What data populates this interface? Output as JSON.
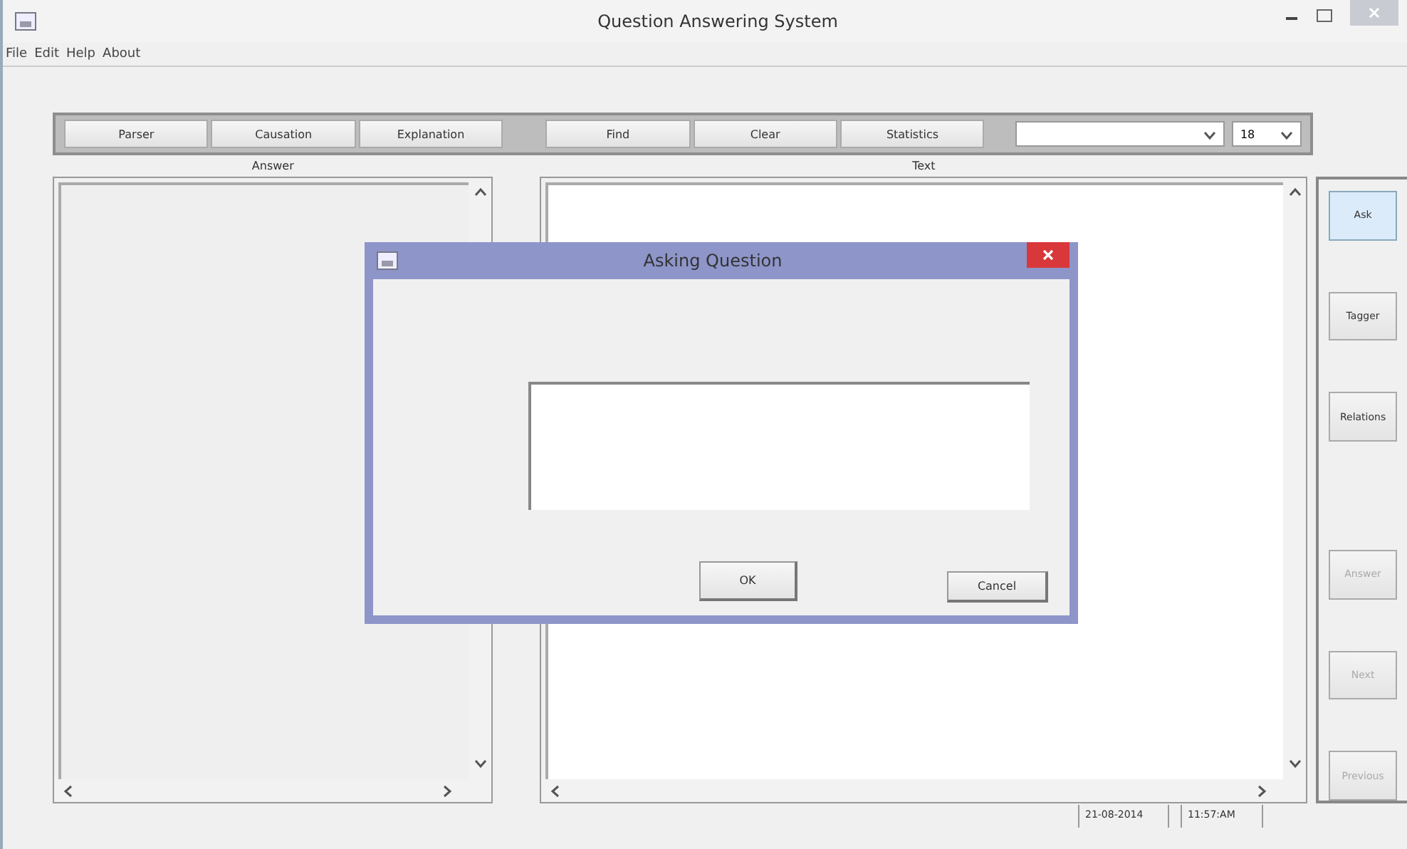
{
  "window": {
    "title": "Question Answering System"
  },
  "menu": [
    "File",
    "Edit",
    "Help",
    "About"
  ],
  "toolbar": {
    "groups": [
      [
        "Parser",
        "Causation",
        "Explanation"
      ],
      [
        "Find",
        "Clear",
        "Statistics"
      ]
    ],
    "size_combo": {
      "value": "18"
    }
  },
  "answer_pane": {
    "label": "Answer"
  },
  "text_pane": {
    "label": "Text"
  },
  "side_buttons": [
    {
      "label": "Ask",
      "focused": true,
      "disabled": false
    },
    {
      "label": "Tagger",
      "focused": false,
      "disabled": false
    },
    {
      "label": "Relations",
      "focused": false,
      "disabled": false
    },
    {
      "label": "Answer",
      "focused": false,
      "disabled": true
    },
    {
      "label": "Next",
      "focused": false,
      "disabled": true
    },
    {
      "label": "Previous",
      "focused": false,
      "disabled": true
    }
  ],
  "status_bar": {
    "date": "21-08-2014",
    "time": "11:57:AM"
  },
  "dialog": {
    "title": "Asking Question",
    "buttons": [
      "OK",
      "Cancel"
    ]
  }
}
